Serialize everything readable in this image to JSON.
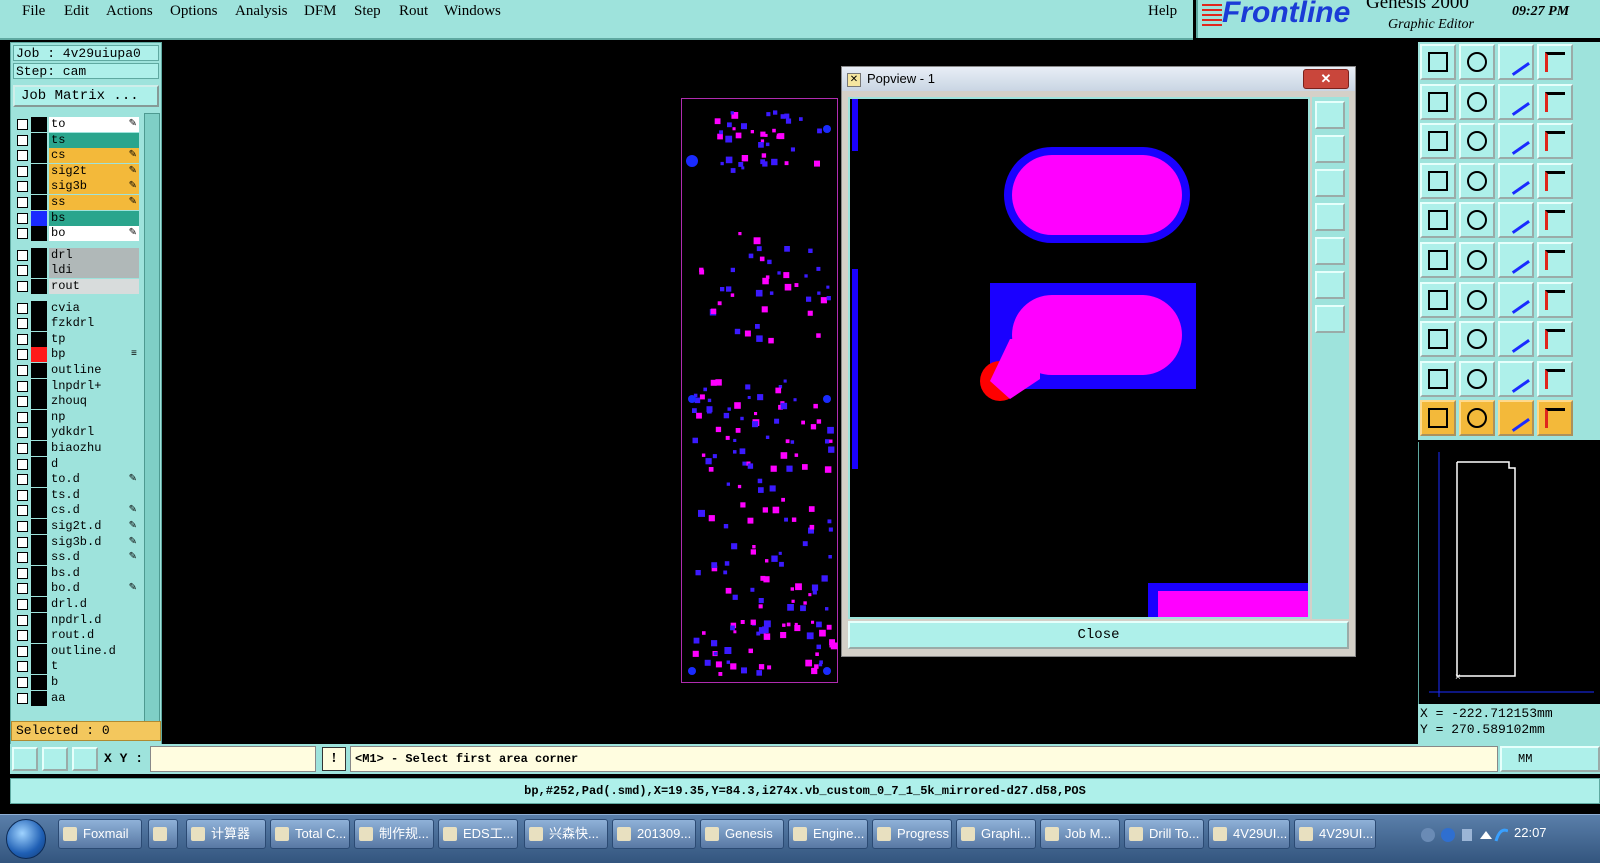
{
  "menubar": {
    "items": [
      "File",
      "Edit",
      "Actions",
      "Options",
      "Analysis",
      "DFM",
      "Step",
      "Rout",
      "Windows"
    ],
    "help": "Help"
  },
  "brand": {
    "logo": "Frontline",
    "product": "Genesis 2000",
    "subtitle": "Graphic Editor",
    "time": "09:27 PM"
  },
  "job": {
    "job_label": "Job : 4v29uiupa0",
    "step_label": "Step: cam",
    "matrix_button": "Job Matrix ..."
  },
  "layers": [
    {
      "name": "to",
      "color": "#ffffff",
      "swatch": "#000000",
      "mark": "✎"
    },
    {
      "name": "ts",
      "color": "#2aa58d",
      "swatch": "#000000",
      "mark": ""
    },
    {
      "name": "cs",
      "color": "#f3b93a",
      "swatch": "#000000",
      "mark": "✎"
    },
    {
      "name": "sig2t",
      "color": "#f3b93a",
      "swatch": "#000000",
      "mark": "✎"
    },
    {
      "name": "sig3b",
      "color": "#f3b93a",
      "swatch": "#000000",
      "mark": "✎"
    },
    {
      "name": "ss",
      "color": "#f3b93a",
      "swatch": "#000000",
      "mark": "✎"
    },
    {
      "name": "bs",
      "color": "#2aa58d",
      "swatch": "#1a2bff",
      "mark": ""
    },
    {
      "name": "bo",
      "color": "#ffffff",
      "swatch": "#000000",
      "mark": "✎"
    },
    {
      "name": "drl",
      "color": "#b0b8b8",
      "swatch": "#000000",
      "mark": ""
    },
    {
      "name": "ldi",
      "color": "#b0b8b8",
      "swatch": "#000000",
      "mark": ""
    },
    {
      "name": "rout",
      "color": "#d8dcdc",
      "swatch": "#000000",
      "mark": ""
    },
    {
      "name": "cvia",
      "color": "#9ee3dc",
      "swatch": "#000000",
      "mark": ""
    },
    {
      "name": "fzkdrl",
      "color": "#9ee3dc",
      "swatch": "#000000",
      "mark": ""
    },
    {
      "name": "tp",
      "color": "#9ee3dc",
      "swatch": "#000000",
      "mark": ""
    },
    {
      "name": "bp",
      "color": "#9ee3dc",
      "swatch": "#ff1a1a",
      "mark": "≡"
    },
    {
      "name": "outline",
      "color": "#9ee3dc",
      "swatch": "#000000",
      "mark": ""
    },
    {
      "name": "lnpdrl+",
      "color": "#9ee3dc",
      "swatch": "#000000",
      "mark": ""
    },
    {
      "name": "zhouq",
      "color": "#9ee3dc",
      "swatch": "#000000",
      "mark": ""
    },
    {
      "name": "np",
      "color": "#9ee3dc",
      "swatch": "#000000",
      "mark": ""
    },
    {
      "name": "ydkdrl",
      "color": "#9ee3dc",
      "swatch": "#000000",
      "mark": ""
    },
    {
      "name": "biaozhu",
      "color": "#9ee3dc",
      "swatch": "#000000",
      "mark": ""
    },
    {
      "name": "d",
      "color": "#9ee3dc",
      "swatch": "#000000",
      "mark": ""
    },
    {
      "name": "to.d",
      "color": "#9ee3dc",
      "swatch": "#000000",
      "mark": "✎"
    },
    {
      "name": "ts.d",
      "color": "#9ee3dc",
      "swatch": "#000000",
      "mark": ""
    },
    {
      "name": "cs.d",
      "color": "#9ee3dc",
      "swatch": "#000000",
      "mark": "✎"
    },
    {
      "name": "sig2t.d",
      "color": "#9ee3dc",
      "swatch": "#000000",
      "mark": "✎"
    },
    {
      "name": "sig3b.d",
      "color": "#9ee3dc",
      "swatch": "#000000",
      "mark": "✎"
    },
    {
      "name": "ss.d",
      "color": "#9ee3dc",
      "swatch": "#000000",
      "mark": "✎"
    },
    {
      "name": "bs.d",
      "color": "#9ee3dc",
      "swatch": "#000000",
      "mark": ""
    },
    {
      "name": "bo.d",
      "color": "#9ee3dc",
      "swatch": "#000000",
      "mark": "✎"
    },
    {
      "name": "drl.d",
      "color": "#9ee3dc",
      "swatch": "#000000",
      "mark": ""
    },
    {
      "name": "npdrl.d",
      "color": "#9ee3dc",
      "swatch": "#000000",
      "mark": ""
    },
    {
      "name": "rout.d",
      "color": "#9ee3dc",
      "swatch": "#000000",
      "mark": ""
    },
    {
      "name": "outline.d",
      "color": "#9ee3dc",
      "swatch": "#000000",
      "mark": ""
    },
    {
      "name": "t",
      "color": "#9ee3dc",
      "swatch": "#000000",
      "mark": ""
    },
    {
      "name": "b",
      "color": "#9ee3dc",
      "swatch": "#000000",
      "mark": ""
    },
    {
      "name": "aa",
      "color": "#9ee3dc",
      "swatch": "#000000",
      "mark": ""
    }
  ],
  "selected": "Selected : 0",
  "popview": {
    "title": "Popview - 1",
    "close_label": "Close"
  },
  "coords": {
    "x": "X =  -222.712153mm",
    "y": "Y =  270.589102mm"
  },
  "command": {
    "xy_label": "X Y :",
    "xy_value": "",
    "warn": "!",
    "prompt": "<M1> - Select first area corner",
    "unit": "MM"
  },
  "status": "bp,#252,Pad(.smd),X=19.35,Y=84.3,i274x.vb_custom_0_7_1_5k_mirrored-d27.d58,POS",
  "taskbar": {
    "items": [
      "Foxmail",
      "",
      "计算器",
      "Total C...",
      "制作规...",
      "EDS工...",
      "兴森快...",
      "201309...",
      "Genesis",
      "Engine...",
      "Progress",
      "Graphi...",
      "Job M...",
      "Drill To...",
      "4V29UI...",
      "4V29UI..."
    ],
    "clock": "22:07"
  },
  "colors": {
    "panel": "#9ee3dc",
    "pad_magenta": "#ff00ff",
    "pad_blue": "#1a00ff",
    "highlight_red": "#ff0000"
  }
}
